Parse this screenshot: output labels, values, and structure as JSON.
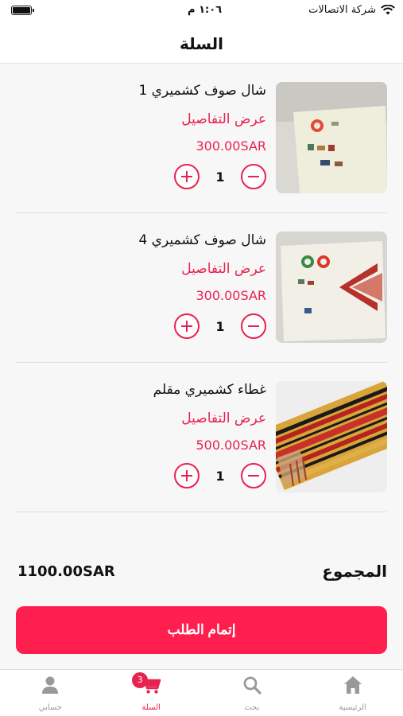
{
  "status_bar": {
    "time": "١:٠٦ م",
    "carrier": "شركة الاتصالات"
  },
  "header": {
    "title": "السلة"
  },
  "cart": {
    "items": [
      {
        "name": "شال صوف كشميري 1",
        "details_label": "عرض التفاصيل",
        "price": "300.00SAR",
        "quantity": "1"
      },
      {
        "name": "شال صوف كشميري 4",
        "details_label": "عرض التفاصيل",
        "price": "300.00SAR",
        "quantity": "1"
      },
      {
        "name": "غطاء كشميري مقلم",
        "details_label": "عرض التفاصيل",
        "price": "500.00SAR",
        "quantity": "1"
      }
    ]
  },
  "total": {
    "label": "المجموع",
    "amount": "1100.00SAR"
  },
  "checkout_label": "إتمام الطلب",
  "tabbar": {
    "tabs": [
      {
        "label": "حسابي",
        "icon": "person-icon"
      },
      {
        "label": "السلة",
        "icon": "cart-icon",
        "badge": "3"
      },
      {
        "label": "بحث",
        "icon": "search-icon"
      },
      {
        "label": "الرئيسية",
        "icon": "home-icon"
      }
    ]
  },
  "colors": {
    "accent": "#e8224f",
    "button": "#ff1f4e",
    "inactive": "#999999"
  }
}
